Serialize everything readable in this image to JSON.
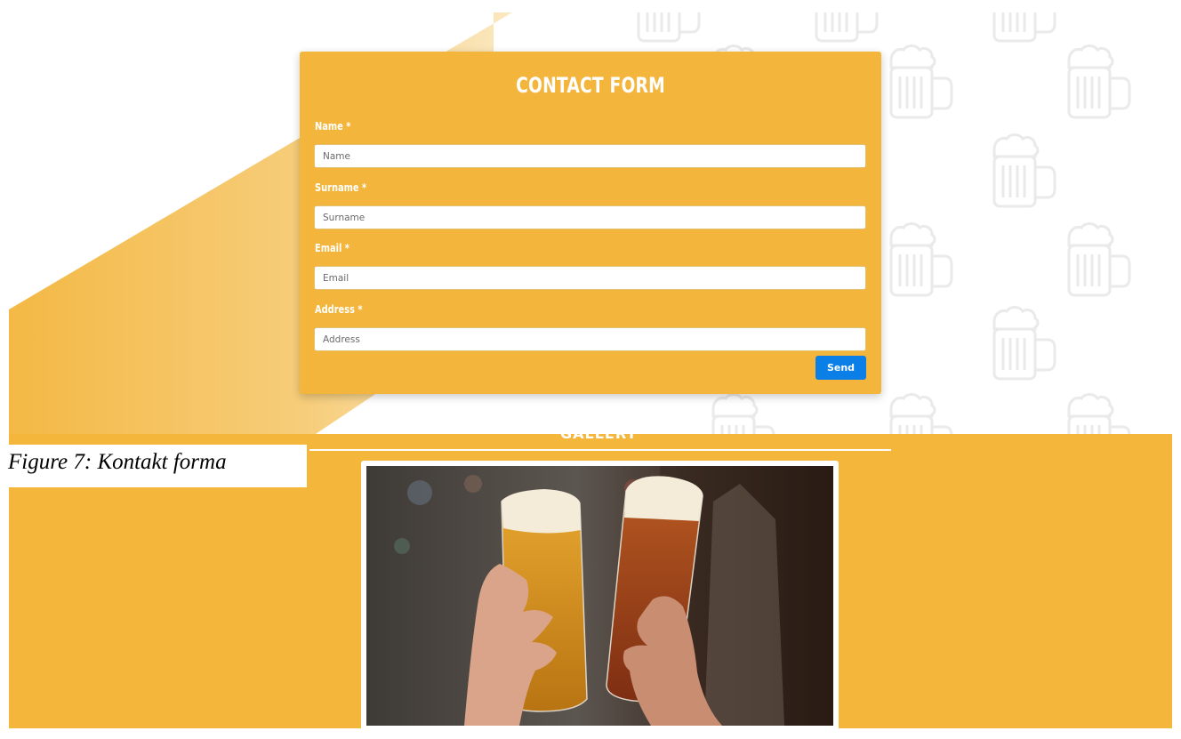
{
  "contact_form": {
    "title": "CONTACT FORM",
    "fields": [
      {
        "label": "Name *",
        "placeholder": "Name"
      },
      {
        "label": "Surname *",
        "placeholder": "Surname"
      },
      {
        "label": "Email *",
        "placeholder": "Email"
      },
      {
        "label": "Address *",
        "placeholder": "Address"
      }
    ],
    "submit_label": "Send"
  },
  "gallery": {
    "heading": "GALLERY",
    "image_icon": "beer-toast-photo"
  },
  "caption": "Figure 7: Kontakt forma",
  "background_icon": "beer-mug-icon",
  "colors": {
    "accent": "#f4b63b",
    "accent_pale": "#f6cb75",
    "button": "#0b7fe8",
    "text_light": "#ffffff",
    "input_border": "#e0c071"
  }
}
